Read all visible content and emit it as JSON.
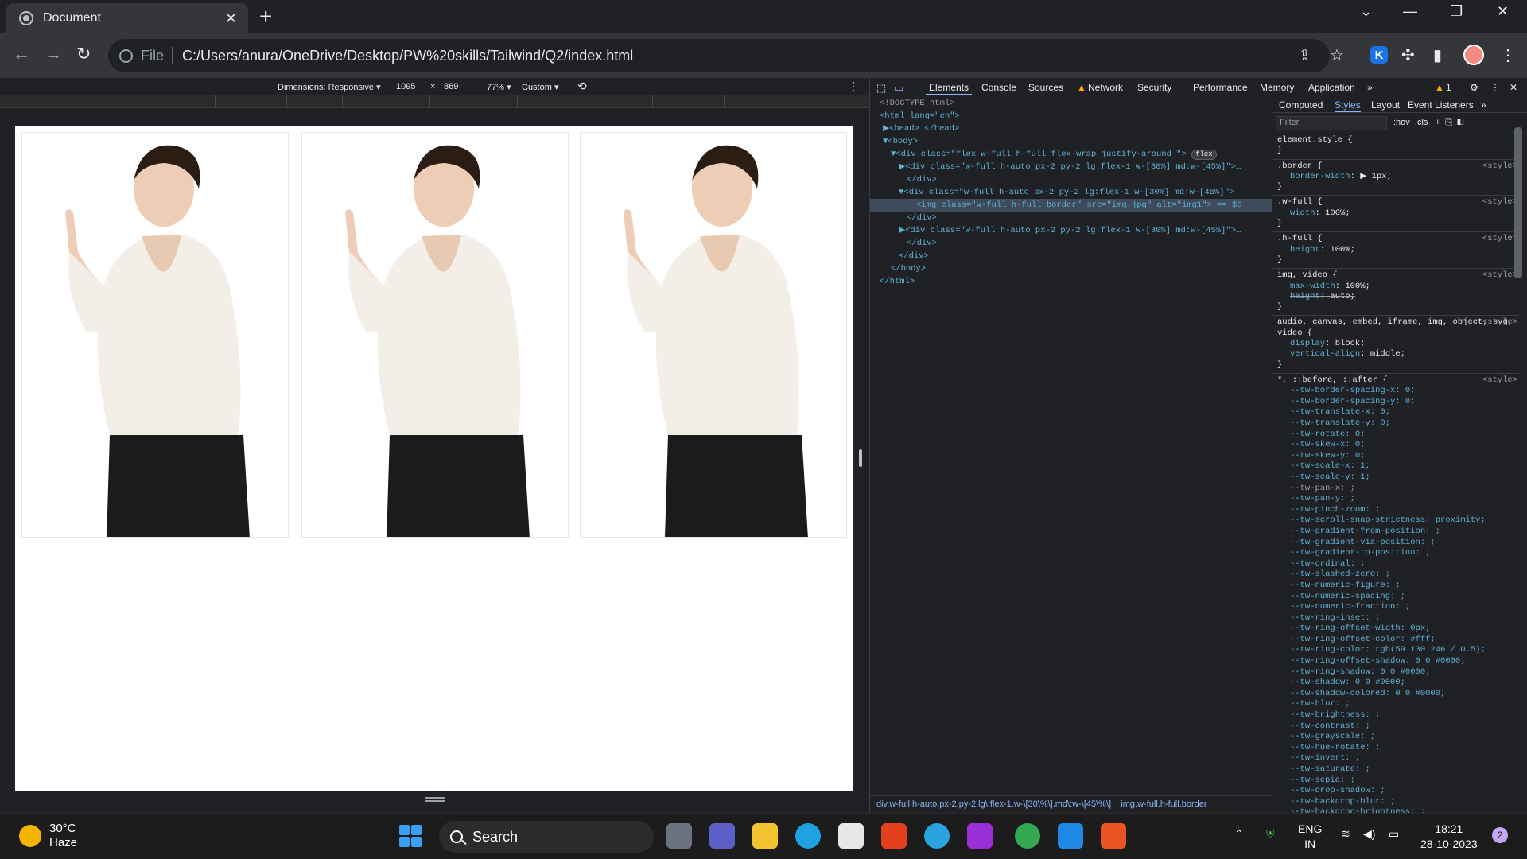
{
  "browser": {
    "tab_title": "Document",
    "close_glyph": "✕",
    "newtab_glyph": "+",
    "scheme": "File",
    "url": "C:/Users/anura/OneDrive/Desktop/PW%20skills/Tailwind/Q2/index.html",
    "window_controls": [
      "⌄",
      "—",
      "❐",
      "✕"
    ],
    "nav": {
      "back": "←",
      "forward": "→",
      "reload": "↻"
    },
    "k_label": "K"
  },
  "device_toolbar": {
    "dimensions_label": "Dimensions: Responsive ▾",
    "width": "1095",
    "times": "×",
    "height": "869",
    "zoom": "77% ▾",
    "throttle": "Custom ▾"
  },
  "page": {
    "image_alt": "img1",
    "card_count": 3
  },
  "devtools": {
    "tabs": [
      "Elements",
      "Console",
      "Sources",
      "Network",
      "Security",
      "Performance",
      "Memory",
      "Application"
    ],
    "warning_count": "1",
    "dom_lines": [
      "<!DOCTYPE html>",
      "<html lang=\"en\">",
      "▶<head>…</head>",
      "▼<body>",
      "▼<div class=\"flex w-full h-full flex-wrap justify-around \">",
      "▶<div class=\"w-full h-auto px-2 py-2 lg:flex-1 w-[30%] md:w-[45%]\">…",
      "</div>",
      "▼<div class=\"w-full h-auto px-2 py-2 lg:flex-1 w-[30%] md:w-[45%]\">",
      "<img class=\"w-full h-full border\" src=\"img.jpg\" alt=\"img1\"> == $0",
      "</div>",
      "▶<div class=\"w-full h-auto px-2 py-2 lg:flex-1 w-[30%] md:w-[45%]\">…",
      "</div>",
      "</div>",
      "</body>",
      "</html>"
    ],
    "flex_badge": "flex",
    "breadcrumb_1": "div.w-full.h-auto.px-2.py-2.lg\\:flex-1.w-\\[30\\%\\].md\\:w-\\[45\\%\\]",
    "breadcrumb_2": "img.w-full.h-full.border",
    "styles_tabs": [
      "Computed",
      "Styles",
      "Layout",
      "Event Listeners"
    ],
    "filter_placeholder": "Filter",
    "hov": ":hov",
    "cls": ".cls",
    "src_label": "<style>",
    "rules": [
      {
        "selector": "element.style {",
        "props": []
      },
      {
        "selector": ".border {",
        "props": [
          {
            "n": "border-width",
            "v": "▶ 1px;"
          }
        ]
      },
      {
        "selector": ".w-full {",
        "props": [
          {
            "n": "width",
            "v": "100%;"
          }
        ]
      },
      {
        "selector": ".h-full {",
        "props": [
          {
            "n": "height",
            "v": "100%;"
          }
        ]
      },
      {
        "selector": "img, video {",
        "props": [
          {
            "n": "max-width",
            "v": "100%;"
          },
          {
            "n": "height",
            "v": "auto;",
            "s": true
          }
        ]
      },
      {
        "selector": "audio, canvas, embed, iframe, img, object, svg, video {",
        "props": [
          {
            "n": "display",
            "v": "block;"
          },
          {
            "n": "vertical-align",
            "v": "middle;"
          }
        ]
      }
    ],
    "tw_vars": [
      "--tw-border-spacing-x: 0;",
      "--tw-border-spacing-y: 0;",
      "--tw-translate-x: 0;",
      "--tw-translate-y: 0;",
      "--tw-rotate: 0;",
      "--tw-skew-x: 0;",
      "--tw-skew-y: 0;",
      "--tw-scale-x: 1;",
      "--tw-scale-y: 1;",
      "--tw-pan-x: ;",
      "--tw-pan-y: ;",
      "--tw-pinch-zoom: ;",
      "--tw-scroll-snap-strictness: proximity;",
      "--tw-gradient-from-position: ;",
      "--tw-gradient-via-position: ;",
      "--tw-gradient-to-position: ;",
      "--tw-ordinal: ;",
      "--tw-slashed-zero: ;",
      "--tw-numeric-figure: ;",
      "--tw-numeric-spacing: ;",
      "--tw-numeric-fraction: ;",
      "--tw-ring-inset: ;",
      "--tw-ring-offset-width: 0px;",
      "--tw-ring-offset-color: #fff;",
      "--tw-ring-color: rgb(59 130 246 / 0.5);",
      "--tw-ring-offset-shadow: 0 0 #0000;",
      "--tw-ring-shadow: 0 0 #0000;",
      "--tw-shadow: 0 0 #0000;",
      "--tw-shadow-colored: 0 0 #0000;",
      "--tw-blur: ;",
      "--tw-brightness: ;",
      "--tw-contrast: ;",
      "--tw-grayscale: ;",
      "--tw-hue-rotate: ;",
      "--tw-invert: ;",
      "--tw-saturate: ;",
      "--tw-sepia: ;",
      "--tw-drop-shadow: ;",
      "--tw-backdrop-blur: ;",
      "--tw-backdrop-brightness: ;"
    ],
    "universal_selector": "*, ::before, ::after {"
  },
  "taskbar": {
    "temp": "30°C",
    "weather": "Haze",
    "search": "Search",
    "lang1": "ENG",
    "lang2": "IN",
    "time": "18:21",
    "date": "28-10-2023",
    "notif": "2"
  },
  "colors": {
    "accent": "#8ab4f8",
    "selected_row": "#3f4b5a"
  }
}
